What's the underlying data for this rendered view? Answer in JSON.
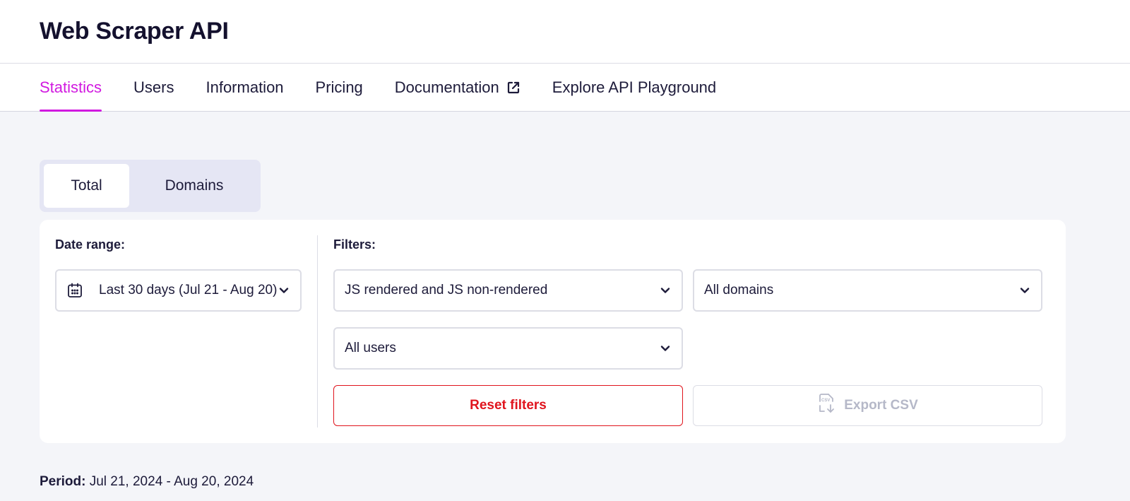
{
  "header": {
    "title": "Web Scraper API"
  },
  "nav": {
    "tabs": [
      {
        "label": "Statistics",
        "active": true
      },
      {
        "label": "Users"
      },
      {
        "label": "Information"
      },
      {
        "label": "Pricing"
      },
      {
        "label": "Documentation",
        "icon": "external-link-icon"
      },
      {
        "label": "Explore API Playground"
      }
    ]
  },
  "view_toggle": {
    "options": [
      "Total",
      "Domains"
    ],
    "selected": "Total"
  },
  "date_range": {
    "label": "Date range:",
    "value": "Last 30 days (Jul 21 - Aug 20)",
    "icon": "calendar-icon"
  },
  "filters": {
    "label": "Filters:",
    "rendering": "JS rendered and JS non-rendered",
    "domains": "All domains",
    "users": "All users"
  },
  "actions": {
    "reset_label": "Reset filters",
    "export_label": "Export CSV",
    "export_icon": "csv-download-icon"
  },
  "period": {
    "label": "Period:",
    "value": "Jul 21, 2024 - Aug 20, 2024"
  },
  "colors": {
    "accent": "#d11ae0",
    "danger": "#e0141d",
    "disabled": "#b5b8c8"
  }
}
